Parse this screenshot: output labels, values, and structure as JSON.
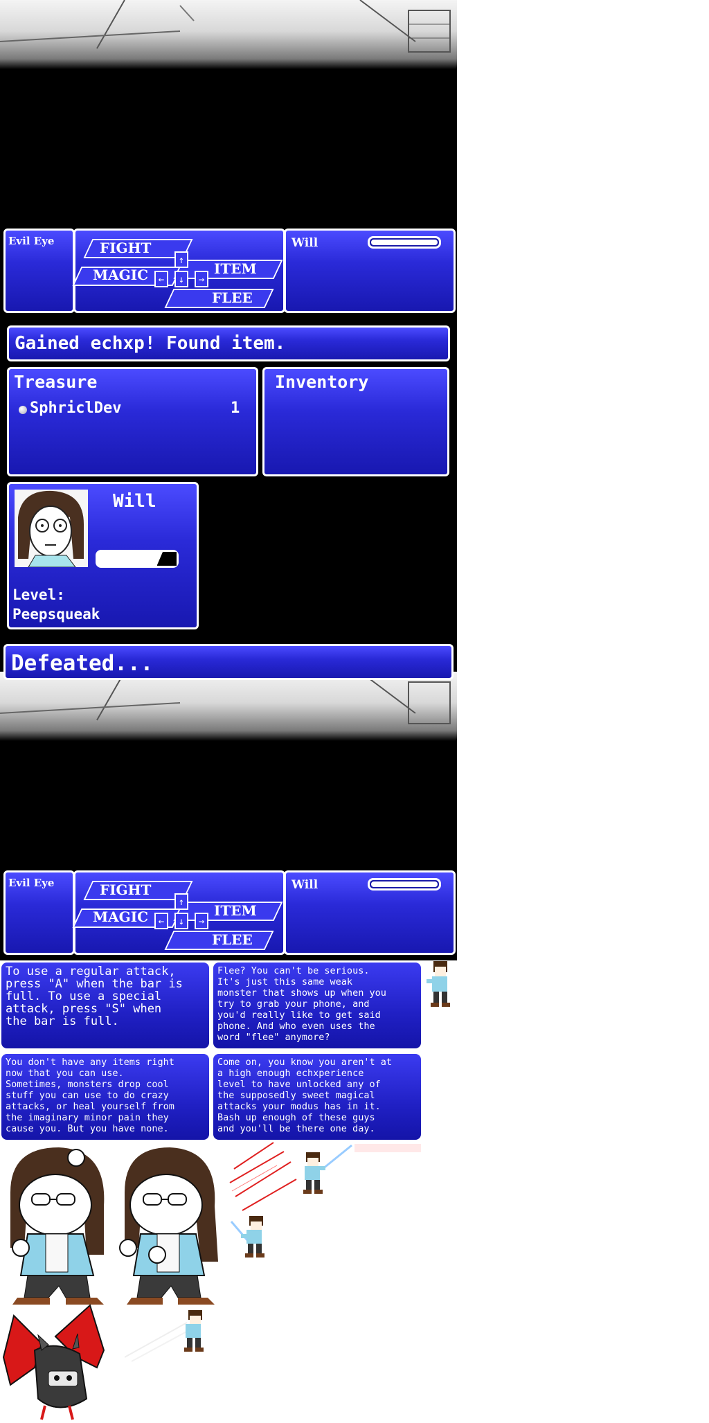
{
  "battle1": {
    "enemy_name": "Evil Eye",
    "commands": {
      "fight": "FIGHT",
      "magic": "MAGIC",
      "item": "ITEM",
      "flee": "FLEE"
    },
    "keys": {
      "up": "↑",
      "left": "←",
      "down": "↓",
      "right": "→"
    },
    "party_name": "Will",
    "hp_fill": 1.0
  },
  "results": {
    "message": "Gained echxp! Found item.",
    "treasure_title": "Treasure",
    "treasure_item": "SphriclDev",
    "treasure_qty": "1",
    "inventory_title": "Inventory",
    "char_name": "Will",
    "exp_fill": 0.75,
    "level_label": "Level:",
    "level_value": "Peepsqueak"
  },
  "defeat": {
    "message": "Defeated..."
  },
  "battle2": {
    "enemy_name": "Evil Eye",
    "commands": {
      "fight": "FIGHT",
      "magic": "MAGIC",
      "item": "ITEM",
      "flee": "FLEE"
    },
    "keys": {
      "up": "↑",
      "left": "←",
      "down": "↓",
      "right": "→"
    },
    "party_name": "Will",
    "hp_fill": 1.0
  },
  "tips": {
    "fight": "To use a regular attack,\npress \"A\" when the bar is\nfull. To use a special\nattack,  press \"S\" when\nthe bar is full.",
    "flee": "Flee? You can't be serious.\nIt's just this same weak\nmonster that shows up when you\ntry to grab your phone, and\nyou'd really like to get said\nphone. And who even uses the\nword \"flee\" anymore?",
    "item": "You don't have any items right\nnow that you can use.\nSometimes, monsters drop cool\nstuff you can use to do crazy\nattacks, or heal yourself from\nthe imaginary minor pain they\ncause you. But you have none.",
    "magic": "Come on, you know you aren't at\na high enough echxperience\nlevel to have unlocked any of\nthe supposedly sweet magical\nattacks your modus has in it.\nBash up enough of these guys\nand you'll be there one day."
  },
  "colors": {
    "panel": "#2a2ad8",
    "border": "#ffffff",
    "background": "#000000",
    "slash": "#e02020",
    "bat": "#d81818"
  }
}
